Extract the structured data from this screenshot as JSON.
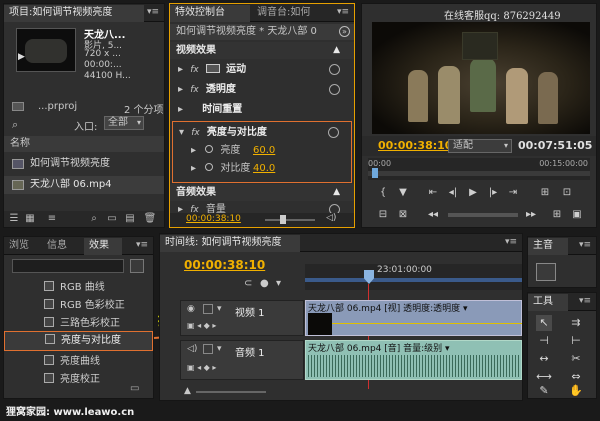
{
  "project": {
    "tab_label": "项目:如何调节视频亮度",
    "clip_title": "天龙八...",
    "clip_type": "影片, 5...",
    "clip_res": "720 x ...",
    "clip_time": "00:00:...",
    "clip_audio": "44100 H...",
    "project_file": "...prproj",
    "item_count": "2 个分项",
    "entry_label": "入口:",
    "entry_value": "全部",
    "name_header": "名称",
    "items": [
      {
        "label": "如何调节视频亮度"
      },
      {
        "label": "天龙八部 06.mp4"
      }
    ]
  },
  "effects_control": {
    "tab_label": "特效控制台",
    "tab2_label": "调音台:如何",
    "header_text": "如何调节视频亮度 * 天龙八部 0",
    "video_section": "视频效果",
    "motion": "运动",
    "opacity": "透明度",
    "time_remap": "时间重置",
    "bc_effect": "亮度与对比度",
    "brightness_label": "亮度",
    "brightness_value": "60.0",
    "contrast_label": "对比度",
    "contrast_value": "40.0",
    "audio_section": "音频效果",
    "volume": "音量",
    "timecode": "00:00:38:10"
  },
  "monitor": {
    "watermark": "在线客服qq: 876292449",
    "timecode": "00:00:38:10",
    "fit": "适配",
    "duration": "00:07:51:05",
    "ruler_start": "00:00",
    "ruler_end": "00:15:00:00"
  },
  "effects_panel": {
    "tabs": [
      "浏览",
      "信息",
      "效果"
    ],
    "items": [
      {
        "label": "RGB 曲线"
      },
      {
        "label": "RGB 色彩校正"
      },
      {
        "label": "三路色彩校正"
      },
      {
        "label": "亮度与对比度"
      },
      {
        "label": "亮度曲线"
      },
      {
        "label": "亮度校正"
      }
    ]
  },
  "annotation": "拖拽",
  "timeline": {
    "tab_label": "时间线: 如何调节视频亮度",
    "timecode": "00:00:38:10",
    "ruler_mark": "23:01:00:00",
    "video_track": "视频 1",
    "video_clip": "天龙八部 06.mp4 [视] 透明度:透明度 ▾",
    "audio_track": "音频 1",
    "audio_clip": "天龙八部 06.mp4 [音] 音量:级别 ▾"
  },
  "master": {
    "tab_label": "主音",
    "tools_label": "工具"
  },
  "footer": "狸窝家园: www.leawo.cn"
}
